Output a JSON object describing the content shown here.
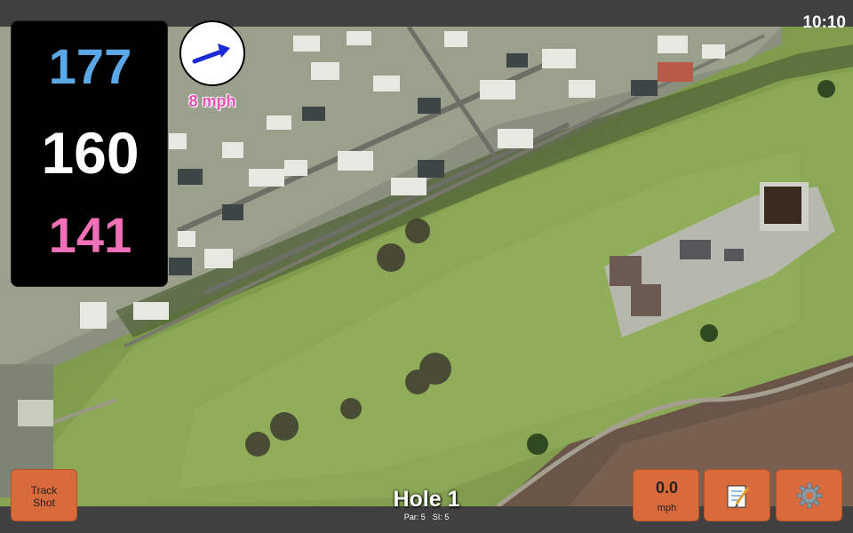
{
  "status_bar": {
    "time": "10:10"
  },
  "distances": {
    "back": "177",
    "middle": "160",
    "front": "141"
  },
  "wind": {
    "speed_label": "8 mph"
  },
  "hole": {
    "title": "Hole 1",
    "par_label": "Par: 5",
    "si_label": "SI: 5"
  },
  "buttons": {
    "track_shot_line1": "Track",
    "track_shot_line2": "Shot",
    "speed_value": "0.0",
    "speed_unit": "mph",
    "notes_icon": "notepad-icon",
    "settings_icon": "gear-icon"
  },
  "colors": {
    "back": "#5aa9e6",
    "middle": "#ffffff",
    "front": "#f070b8",
    "wind_arrow": "#1a2bd6",
    "wind_label": "#e64fb4",
    "button_bg": "#d86a3c"
  }
}
